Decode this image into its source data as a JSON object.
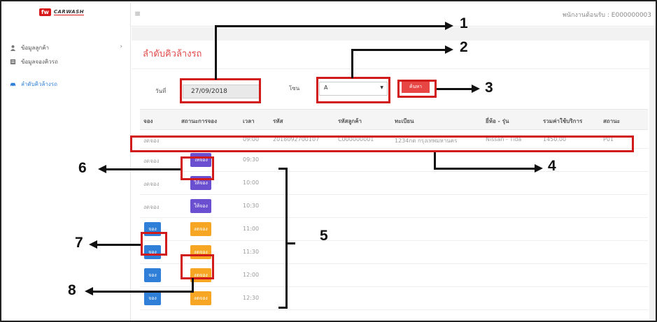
{
  "app": {
    "logo_mark": "fw",
    "logo_word": "CARWASH",
    "employee_label": "พนักงานต้อนรับ : E000000003"
  },
  "sidebar": {
    "items": [
      {
        "label": "ข้อมูลลูกค้า",
        "icon": "user-icon",
        "has_chevron": true
      },
      {
        "label": "ข้อมูลจองคิวรถ",
        "icon": "list-icon"
      },
      {
        "label": "ลำดับคิวล้างรถ",
        "icon": "car-icon",
        "active": true
      }
    ]
  },
  "page": {
    "title": "ลำดับคิวล้างรถ",
    "date_label": "วันที่",
    "date_value": "27/09/2018",
    "zone_label": "โซน",
    "zone_value": "A",
    "search_label": "ค้นหา"
  },
  "table": {
    "columns": [
      "จอง",
      "สถานะการจอง",
      "เวลา",
      "รหัส",
      "รหัสลูกค้า",
      "ทะเบียน",
      "ยี่ห้อ - รุ่น",
      "รวมค่าใช้บริการ",
      "สถานะ"
    ],
    "rows": [
      {
        "reserve": "งดจอง",
        "status": "",
        "time": "09:00",
        "id": "2018092700107",
        "customer": "C000000001",
        "plate": "1234กด กรุงเทพมหานคร",
        "brand": "Nissan - Tida",
        "total": "1450.00",
        "state": "P01"
      },
      {
        "reserve": "งดจอง",
        "status": "ให้จอง",
        "time": "09:30"
      },
      {
        "reserve": "งดจอง",
        "status": "ให้จอง",
        "time": "10:00"
      },
      {
        "reserve": "งดจอง",
        "status": "ให้จอง",
        "time": "10:30"
      },
      {
        "reserve": "จอง",
        "status": "งดจอง",
        "time": "11:00"
      },
      {
        "reserve": "จอง",
        "status": "งดจอง",
        "time": "11:30"
      },
      {
        "reserve": "จอง",
        "status": "งดจอง",
        "time": "12:00"
      },
      {
        "reserve": "จอง",
        "status": "งดจอง",
        "time": "12:30"
      }
    ]
  },
  "callouts": [
    "1",
    "2",
    "3",
    "4",
    "5",
    "6",
    "7",
    "8"
  ],
  "colors": {
    "accent_red": "#e24a4a",
    "annotation_red": "#d11a1a",
    "button_blue": "#2f7fd8",
    "button_purple": "#6a4fd1",
    "button_orange": "#f6a623"
  }
}
